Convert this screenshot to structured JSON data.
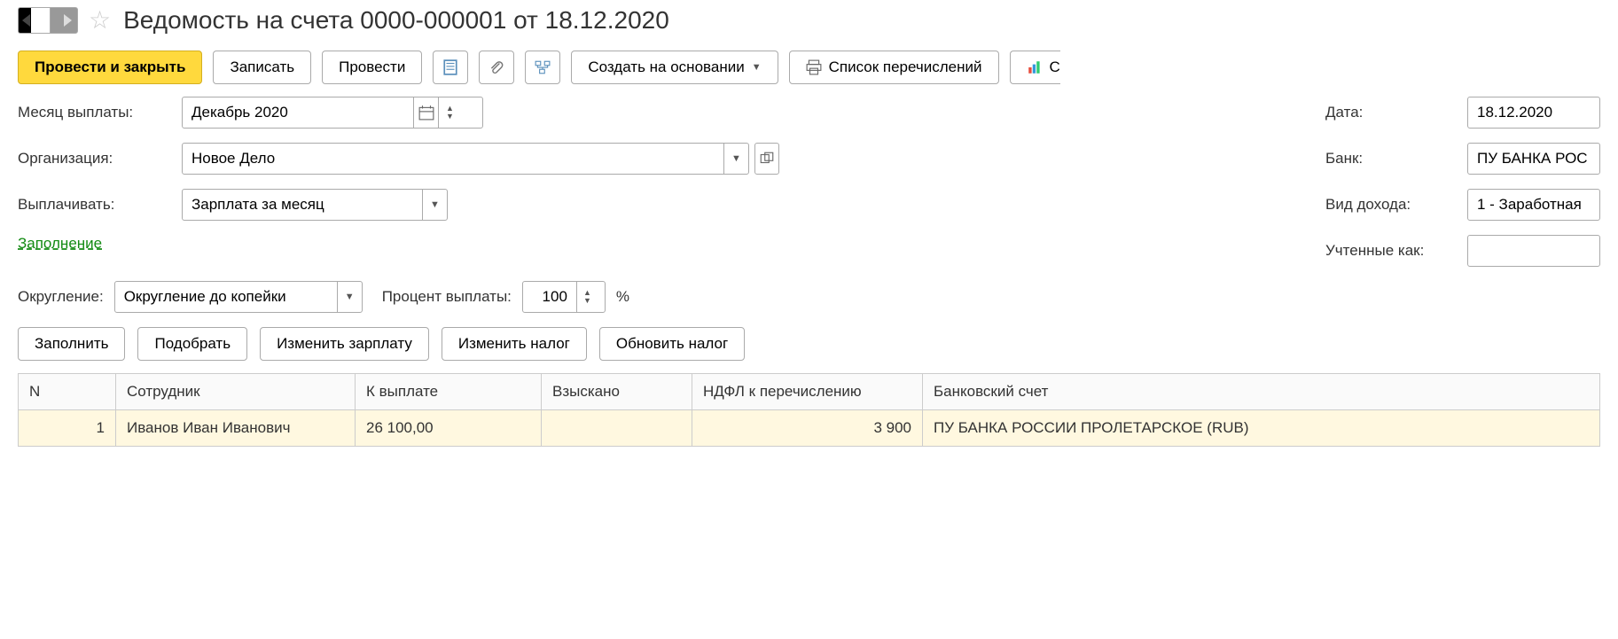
{
  "title": "Ведомость на счета 0000-000001 от 18.12.2020",
  "toolbar": {
    "post_close": "Провести и закрыть",
    "save": "Записать",
    "post": "Провести",
    "create_based": "Создать на основании",
    "transfer_list": "Список перечислений",
    "cutoff_label": "С"
  },
  "form": {
    "month_label": "Месяц выплаты:",
    "month_value": "Декабрь 2020",
    "org_label": "Организация:",
    "org_value": "Новое Дело",
    "pay_label": "Выплачивать:",
    "pay_value": "Зарплата за месяц",
    "fill_link": "Заполнение",
    "round_label": "Округление:",
    "round_value": "Округление до копейки",
    "percent_label": "Процент выплаты:",
    "percent_value": "100",
    "percent_suffix": "%",
    "date_label": "Дата:",
    "date_value": "18.12.2020",
    "bank_label": "Банк:",
    "bank_value": "ПУ БАНКА РОС",
    "income_label": "Вид дохода:",
    "income_value": "1 - Заработная",
    "accounted_label": "Учтенные как:",
    "accounted_value": ""
  },
  "actions": {
    "fill": "Заполнить",
    "pick": "Подобрать",
    "edit_salary": "Изменить зарплату",
    "edit_tax": "Изменить налог",
    "update_tax": "Обновить налог"
  },
  "table": {
    "headers": {
      "n": "N",
      "employee": "Сотрудник",
      "to_pay": "К выплате",
      "collected": "Взыскано",
      "ndfl": "НДФЛ к перечислению",
      "bank_account": "Банковский счет"
    },
    "rows": [
      {
        "n": "1",
        "employee": "Иванов Иван Иванович",
        "to_pay": "26 100,00",
        "collected": "",
        "ndfl": "3 900",
        "bank_account": "ПУ БАНКА РОССИИ ПРОЛЕТАРСКОЕ (RUB)"
      }
    ]
  }
}
